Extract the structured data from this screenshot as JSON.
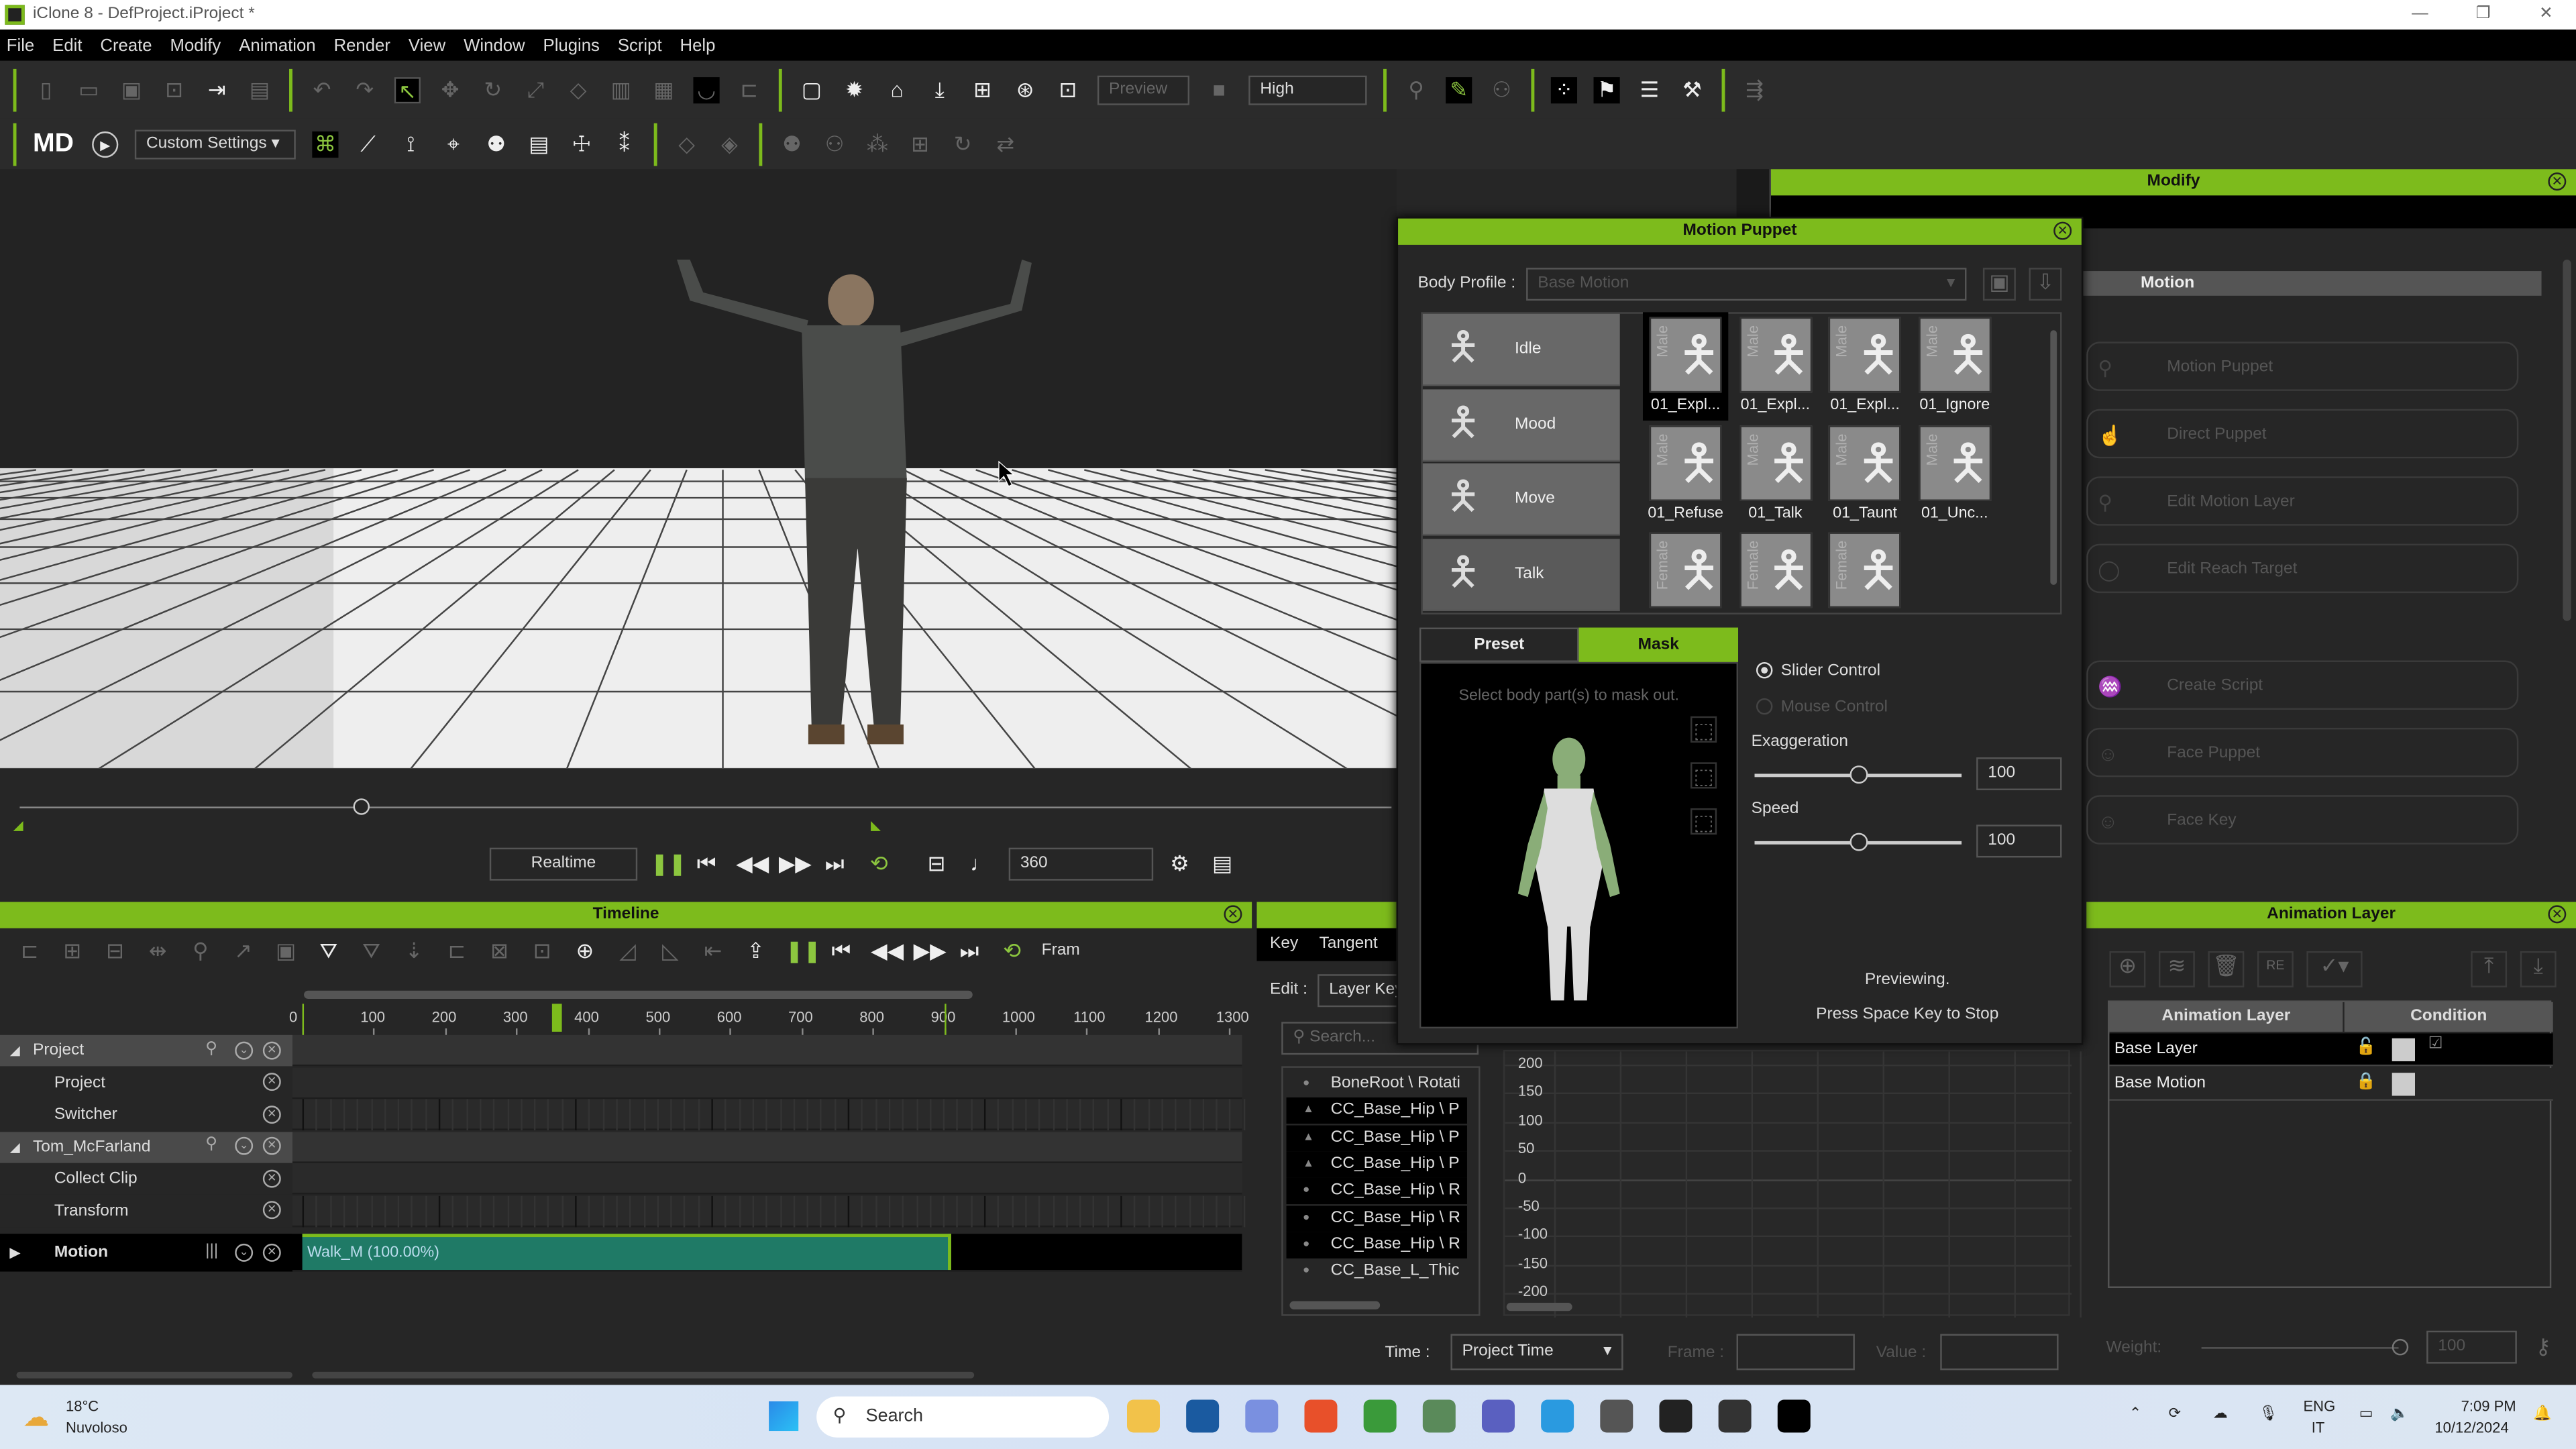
{
  "window": {
    "title": "iClone 8 - DefProject.iProject *"
  },
  "menu": [
    "File",
    "Edit",
    "Create",
    "Modify",
    "Animation",
    "Render",
    "View",
    "Window",
    "Plugins",
    "Script",
    "Help"
  ],
  "toolbar": {
    "preview_label": "Preview",
    "quality": "High",
    "settings": "Custom Settings",
    "logo": "MD"
  },
  "playback": {
    "mode": "Realtime",
    "frame": "360"
  },
  "timeline": {
    "title": "Timeline",
    "frame_label": "Fram",
    "ruler": [
      "0",
      "100",
      "200",
      "300",
      "400",
      "500",
      "600",
      "700",
      "800",
      "900",
      "1000",
      "1100",
      "1200",
      "1300"
    ],
    "current_frame": 360,
    "end_frame": 900,
    "tracks": [
      {
        "name": "Project",
        "group": true
      },
      {
        "name": "Project"
      },
      {
        "name": "Switcher"
      },
      {
        "name": "Tom_McFarland",
        "group": true
      },
      {
        "name": "Collect Clip"
      },
      {
        "name": "Transform"
      },
      {
        "name": "Motion",
        "bold": true
      }
    ],
    "clip": {
      "label": "Walk_M (100.00%)",
      "start": 0,
      "end": 900
    }
  },
  "curve_editor": {
    "tabs": [
      "Key",
      "Tangent"
    ],
    "edit_label": "Edit :",
    "edit_value": "Layer Key",
    "search_placeholder": "Search...",
    "bones": [
      "BoneRoot \\ Rotati",
      "CC_Base_Hip \\ P",
      "CC_Base_Hip \\ P",
      "CC_Base_Hip \\ P",
      "CC_Base_Hip \\ R",
      "CC_Base_Hip \\ R",
      "CC_Base_Hip \\ R",
      "CC_Base_L_Thic"
    ],
    "y_ticks": [
      "200",
      "150",
      "100",
      "50",
      "0",
      "-50",
      "-100",
      "-150",
      "-200"
    ],
    "time_label": "Time :",
    "time_value": "Project Time",
    "frame_label": "Frame :",
    "value_label": "Value :"
  },
  "motion_puppet": {
    "title": "Motion Puppet",
    "body_profile_label": "Body Profile :",
    "body_profile_value": "Base Motion",
    "categories": [
      "Idle",
      "Mood",
      "Move",
      "Talk"
    ],
    "presets": [
      {
        "label": "01_Expl...",
        "tag": "Male"
      },
      {
        "label": "01_Expl...",
        "tag": "Male"
      },
      {
        "label": "01_Expl...",
        "tag": "Male"
      },
      {
        "label": "01_Ignore",
        "tag": "Male"
      },
      {
        "label": "01_Refuse",
        "tag": "Male"
      },
      {
        "label": "01_Talk",
        "tag": "Male"
      },
      {
        "label": "01_Taunt",
        "tag": "Male"
      },
      {
        "label": "01_Unc...",
        "tag": "Male"
      },
      {
        "label": "",
        "tag": "Female"
      },
      {
        "label": "",
        "tag": "Female"
      },
      {
        "label": "",
        "tag": "Female"
      }
    ],
    "tabs": {
      "preset": "Preset",
      "mask": "Mask"
    },
    "mask_hint": "Select body part(s) to mask out.",
    "slider_control": "Slider Control",
    "mouse_control": "Mouse Control",
    "exaggeration_label": "Exaggeration",
    "exaggeration": "100",
    "speed_label": "Speed",
    "speed": "100",
    "status1": "Previewing.",
    "status2": "Press Space Key to Stop"
  },
  "modify": {
    "title": "Modify",
    "section": "Motion",
    "buttons": [
      "Motion Puppet",
      "Direct Puppet",
      "Edit Motion Layer",
      "Edit Reach Target",
      "Create Script",
      "Face Puppet",
      "Face Key"
    ]
  },
  "animation_layer": {
    "title": "Animation Layer",
    "col1": "Animation Layer",
    "col2": "Condition",
    "layers": [
      "Base Layer",
      "Base Motion"
    ],
    "weight_label": "Weight:",
    "weight": "100"
  },
  "taskbar": {
    "temp": "18°C",
    "weather": "Nuvoloso",
    "search": "Search",
    "lang1": "ENG",
    "lang2": "IT",
    "time": "7:09 PM",
    "date": "10/12/2024"
  },
  "colors": {
    "accent": "#7dbb1c",
    "clip": "#1f7a66"
  }
}
